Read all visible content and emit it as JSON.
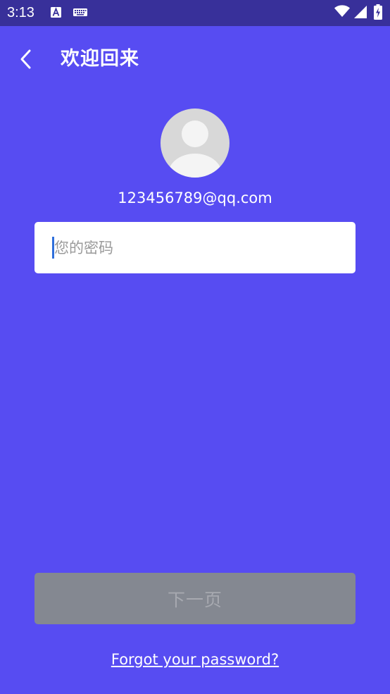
{
  "status_bar": {
    "time": "3:13",
    "icons": [
      "a-notification-icon",
      "keyboard-icon",
      "wifi-icon",
      "cell-signal-icon",
      "battery-charging-icon"
    ],
    "background": "#38309A"
  },
  "toolbar": {
    "back_icon": "chevron-left-icon",
    "title": "欢迎回来"
  },
  "account": {
    "avatar_icon": "default-user-avatar",
    "email": "123456789@qq.com"
  },
  "password": {
    "placeholder": "您的密码",
    "value": ""
  },
  "actions": {
    "next_label": "下一页",
    "next_enabled": false,
    "forgot_label": "Forgot your password?"
  },
  "colors": {
    "background": "#574CF2",
    "status_bar": "#38309A",
    "button_disabled": "#848891",
    "button_text_disabled": "#A7A9B0",
    "cursor": "#2F6FDB"
  }
}
